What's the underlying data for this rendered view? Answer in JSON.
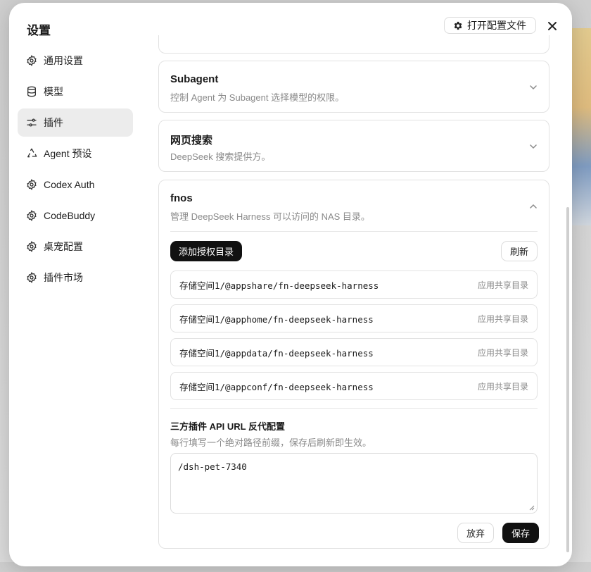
{
  "modal": {
    "title": "设置",
    "open_config_label": "打开配置文件"
  },
  "sidebar": {
    "items": [
      {
        "label": "通用设置",
        "icon": "gear-icon"
      },
      {
        "label": "模型",
        "icon": "database-icon"
      },
      {
        "label": "插件",
        "icon": "sliders-icon",
        "active": true
      },
      {
        "label": "Agent 预设",
        "icon": "recycle-icon"
      },
      {
        "label": "Codex Auth",
        "icon": "gear-icon"
      },
      {
        "label": "CodeBuddy",
        "icon": "gear-icon"
      },
      {
        "label": "桌宠配置",
        "icon": "gear-icon"
      },
      {
        "label": "插件市场",
        "icon": "gear-icon"
      }
    ]
  },
  "cards": {
    "subagent": {
      "title": "Subagent",
      "subtitle": "控制 Agent 为 Subagent 选择模型的权限。"
    },
    "websearch": {
      "title": "网页搜索",
      "subtitle": "DeepSeek 搜索提供方。"
    },
    "fnos": {
      "title": "fnos",
      "subtitle": "管理 DeepSeek Harness 可以访问的 NAS 目录。",
      "add_label": "添加授权目录",
      "refresh_label": "刷新",
      "paths": [
        {
          "path": "存储空间1/@appshare/fn-deepseek-harness",
          "tag": "应用共享目录"
        },
        {
          "path": "存储空间1/@apphome/fn-deepseek-harness",
          "tag": "应用共享目录"
        },
        {
          "path": "存储空间1/@appdata/fn-deepseek-harness",
          "tag": "应用共享目录"
        },
        {
          "path": "存储空间1/@appconf/fn-deepseek-harness",
          "tag": "应用共享目录"
        }
      ],
      "proxy_title": "三方插件 API URL 反代配置",
      "proxy_hint": "每行填写一个绝对路径前缀，保存后刷新即生效。",
      "proxy_value": "/dsh-pet-7340",
      "discard_label": "放弃",
      "save_label": "保存"
    }
  }
}
